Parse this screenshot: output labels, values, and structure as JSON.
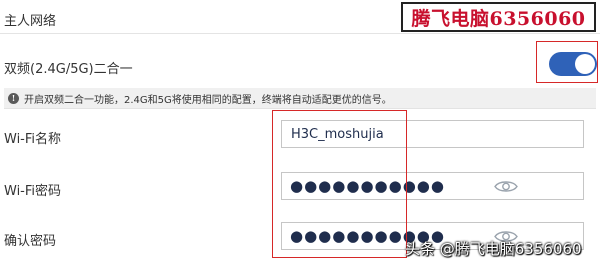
{
  "section": {
    "title": "主人网络"
  },
  "watermark": {
    "top_text": "腾飞电脑6356060",
    "bottom_text": "头条 @腾飞电脑6356060"
  },
  "dual_band": {
    "label": "双频(2.4G/5G)二合一",
    "enabled": true,
    "info_icon": "info-icon",
    "info_text": "开启双频二合一功能，2.4G和5G将使用相同的配置，终端将自动适配更优的信号。"
  },
  "wifi_name": {
    "label": "Wi-Fi名称",
    "value": "H3C_moshujia"
  },
  "wifi_password": {
    "label": "Wi-Fi密码",
    "value": "●●●●●●●●●●●",
    "icon": "eye-icon"
  },
  "confirm_password": {
    "label": "确认密码",
    "value": "●●●●●●●●●●●",
    "icon": "eye-icon"
  },
  "colors": {
    "toggle_on": "#2f62b8",
    "highlight": "#d62828",
    "watermark_red": "#c8102e"
  }
}
